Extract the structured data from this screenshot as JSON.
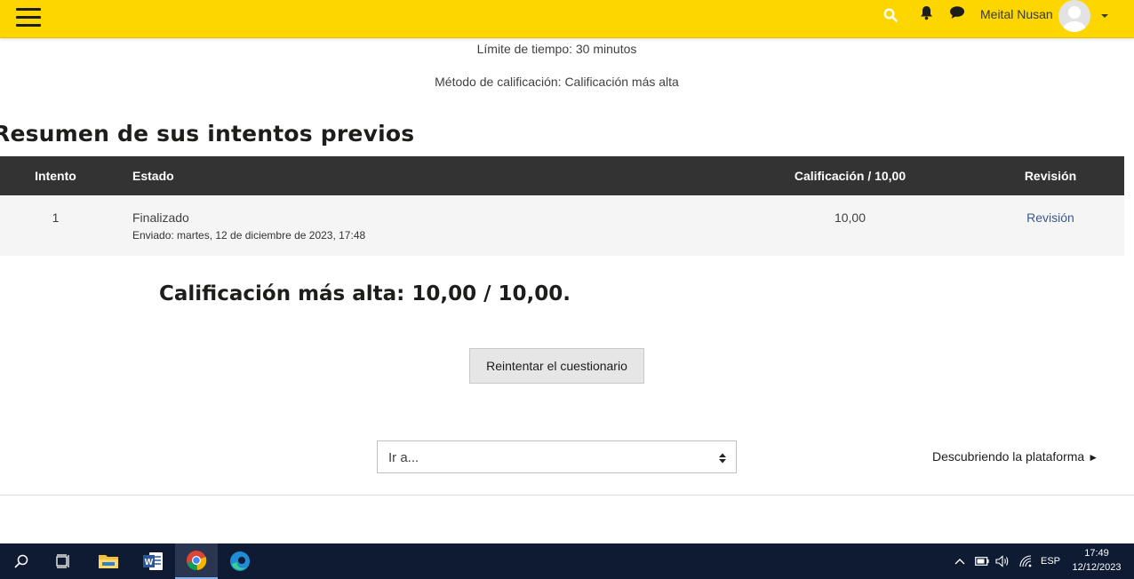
{
  "navbar": {
    "user_name": "Meital Nusan",
    "bg_color": "#fdd600",
    "icons": [
      "menu-icon",
      "search-icon",
      "bell-icon",
      "chat-icon",
      "avatar",
      "caret-down-icon"
    ]
  },
  "info": {
    "time_limit": "Límite de tiempo: 30 minutos",
    "grading_method": "Método de calificación: Calificación más alta"
  },
  "summary": {
    "title": "Resumen de sus intentos previos",
    "columns": [
      "Intento",
      "Estado",
      "Calificación / 10,00",
      "Revisión"
    ],
    "rows": [
      {
        "attempt": "1",
        "state": "Finalizado",
        "submitted": "Enviado: martes, 12 de diciembre de 2023, 17:48",
        "grade": "10,00",
        "review": "Revisión"
      }
    ]
  },
  "highest_grade": "Calificación más alta: 10,00 / 10,00.",
  "retry_button": "Reintentar el cuestionario",
  "jump_select": {
    "selected": "Ir a..."
  },
  "next_activity": {
    "label": "Descubriendo la plataforma",
    "arrow": "►"
  },
  "taskbar": {
    "apps": [
      "search-icon",
      "task-view-icon",
      "file-explorer-icon",
      "word-icon",
      "chrome-icon",
      "edge-icon"
    ],
    "active_app": "chrome-icon",
    "tray": {
      "language": "ESP",
      "time": "17:49",
      "date": "12/12/2023"
    }
  }
}
